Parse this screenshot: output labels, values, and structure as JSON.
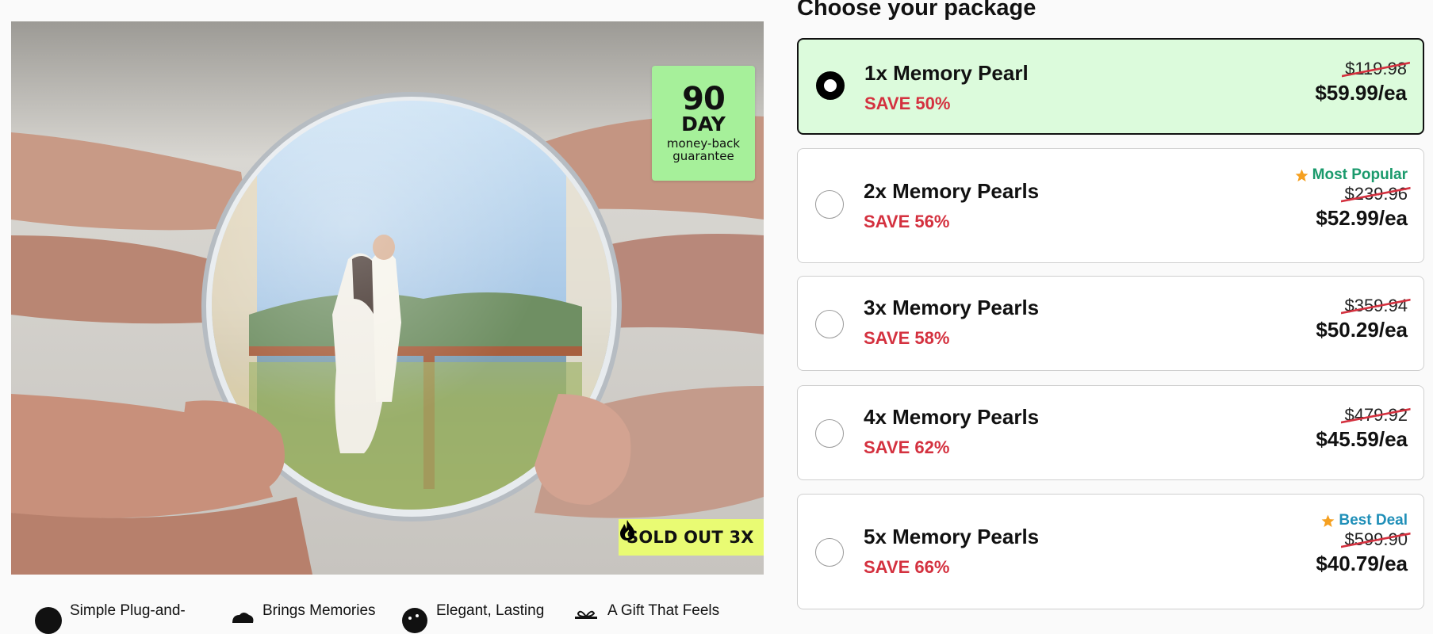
{
  "product_image": {
    "guarantee_badge": {
      "number": "90",
      "unit": "DAY",
      "line1": "money-back",
      "line2": "guarantee"
    },
    "soldout_badge": {
      "text": "SOLD OUT 3X",
      "icon": "flame-icon"
    }
  },
  "features": [
    {
      "label": "Simple Plug-and-",
      "icon": "plug-icon"
    },
    {
      "label": "Brings Memories",
      "icon": "cloud-icon"
    },
    {
      "label": "Elegant, Lasting",
      "icon": "gem-icon"
    },
    {
      "label": "A Gift That Feels",
      "icon": "gift-icon"
    }
  ],
  "packages": {
    "title": "Choose your package",
    "items": [
      {
        "name": "1x Memory Pearl",
        "save": "SAVE 50%",
        "old_price": "$119.98",
        "new_price": "$59.99/ea",
        "tag": "",
        "selected": true
      },
      {
        "name": "2x Memory Pearls",
        "save": "SAVE 56%",
        "old_price": "$239.96",
        "new_price": "$52.99/ea",
        "tag": "Most Popular",
        "tag_color": "#1a9a6c",
        "selected": false
      },
      {
        "name": "3x Memory Pearls",
        "save": "SAVE 58%",
        "old_price": "$359.94",
        "new_price": "$50.29/ea",
        "tag": "",
        "selected": false
      },
      {
        "name": "4x Memory Pearls",
        "save": "SAVE 62%",
        "old_price": "$479.92",
        "new_price": "$45.59/ea",
        "tag": "",
        "selected": false
      },
      {
        "name": "5x Memory Pearls",
        "save": "SAVE 66%",
        "old_price": "$599.90",
        "new_price": "$40.79/ea",
        "tag": "Best Deal",
        "tag_color": "#1f8fb8",
        "selected": false
      }
    ]
  },
  "colors": {
    "accent_green": "#a6f09a",
    "save_red": "#d4313f",
    "selected_bg": "#dcfbdc",
    "soldout_yellow": "#e9fb73",
    "star_orange": "#f5a020"
  }
}
